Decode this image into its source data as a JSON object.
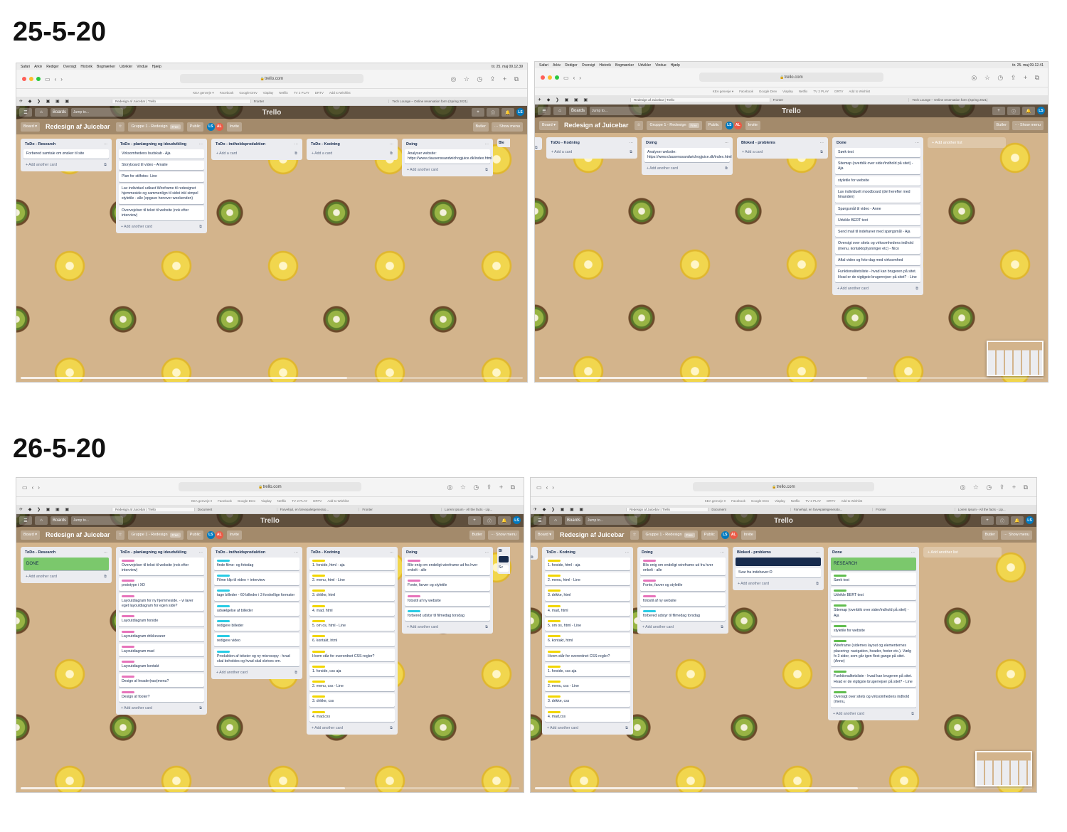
{
  "headings": [
    "25-5-20",
    "26-5-20"
  ],
  "menubar": {
    "apple": "",
    "items": [
      "Safari",
      "Arkiv",
      "Rediger",
      "Oversigt",
      "Historik",
      "Bogmærker",
      "Udvikler",
      "Vindue",
      "Hjælp"
    ],
    "clock_1": "tir. 25. maj 09.12.39",
    "clock_2": "tir. 25. maj 09.12.41"
  },
  "browser": {
    "url": "trello.com",
    "bookmarks": [
      "KEA genveje ▾",
      "Facebook",
      "Google Drev",
      "Viaplay",
      "Netflix",
      "TV 2 PLAY",
      "DRTV",
      "Add to Wishlist"
    ],
    "tabs_a": [
      "Redesign af Juicebar | Trello",
      "Fronter",
      "Tech Lounge – Online reservation form (Spring 2021)"
    ],
    "tabs_b": [
      "Redesign af Juicebar | Trello",
      "Document",
      "Farvehjul, en farvepaletgenerato...",
      "Fronter",
      "Lorem Ipsum - All the facts - Lip..."
    ],
    "pins": "✈ ◆ ❯ ▣ ▣ ▣"
  },
  "trello": {
    "logo": "Trello",
    "boards": "Boards",
    "jump": "Jump to...",
    "board_menu": "Board ▾",
    "board_title": "Redesign af Juicebar",
    "star": "☆",
    "team": "Gruppe 1 - Redesign",
    "free": "Free",
    "public": "Public",
    "invite": "Invite",
    "butler": "Butler",
    "show_menu": "··· Show menu",
    "add_card": "+ Add a card",
    "add_another_card": "+ Add another card",
    "add_another_list": "+ Add another list",
    "list_menu": "···",
    "template_icon": "⧉",
    "avatars": [
      "LS",
      "AL"
    ],
    "user": "LS"
  },
  "colors": {
    "pink": "#e774bb",
    "blue": "#29cce5",
    "yellow": "#f2d600",
    "green": "#61bd4f",
    "navy": "#172b4d",
    "done_cover": "#7bc86c",
    "avatar_blue": "#0079bf",
    "avatar_red": "#eb5a46"
  },
  "shot1": {
    "lists": [
      {
        "title": "ToDo - Research",
        "cards": [
          "Forbered samtale om ønsker til site"
        ],
        "footer": "+ Add another card"
      },
      {
        "title": "ToDo - planlægning og ideudvikling",
        "cards": [
          "Virksomhedens budskab - Aja",
          "Storyboard til video - Amalie",
          "Plan for stilfotos- Line",
          "Lav individuel udkast Wireframe til redesignet hjemmeside og sammenlign til sidst inkl simpel styletile - alle (opgave henover weekenden)",
          "Overvejelser til tekst til website (nok efter interview)"
        ],
        "footer": "+ Add another card"
      },
      {
        "title": "ToDo - indholdsproduktion",
        "cards": [],
        "footer": "+ Add a card"
      },
      {
        "title": "ToDo - Kodning",
        "cards": [],
        "footer": "+ Add a card"
      },
      {
        "title": "Doing",
        "cards": [
          "Analyser website: https://www.clausenssandwichogjuice.dk/index.html"
        ],
        "footer": "+ Add another card"
      }
    ],
    "peek": "Ble"
  },
  "shot2": {
    "lists": [
      {
        "title": "ToDo - Kodning",
        "cards": [],
        "footer": "+ Add a card"
      },
      {
        "title": "Doing",
        "cards": [
          "Analyser website: https://www.clausenssandwichogjuice.dk/index.html"
        ],
        "footer": "+ Add another card"
      },
      {
        "title": "Bloked - problems",
        "cards": [],
        "footer": "+ Add a card"
      },
      {
        "title": "Done",
        "cards": [
          "Søek test",
          "Sitemap (overblik over sider/indhold på sitet) - Aja",
          "styletile for website",
          "Lav individuelt moodboard (del herefter med hinanden)",
          "Spørgsmål til video - Anne",
          "Udvikle BERT test",
          "Send mail til indehaver med spørgsmål - Aja",
          "Oversigt over sitets og virksomhedens indhold (menu, kontaktoplysninger etc) - Nico",
          "Aftal video og foto-dag med virksomhed",
          "Funktionalitetsliste - hvad kan brugeren på sitet. Hvad er de vigtigste brugerrejser på sitet? - Line"
        ],
        "footer": "+ Add another card"
      }
    ]
  },
  "shot3": {
    "research": {
      "title": "ToDo - Research",
      "cover": "DONE",
      "footer": "+ Add another card"
    },
    "planning": {
      "title": "ToDo - planlægning og ideudvikling",
      "cards": [
        {
          "label": "pink",
          "text": "Overvejelser til tekst til website (nok efter interview)"
        },
        {
          "label": "pink",
          "text": "prototype i XD"
        },
        {
          "label": "pink",
          "text": "Layoutdiagram for ny hjemmeside. - vi laver eget layoutdiagram for egen side?"
        },
        {
          "label": "pink",
          "text": "Layoutdiagram forside"
        },
        {
          "label": "pink",
          "text": "Layoutdiagram drikkevarer"
        },
        {
          "label": "pink",
          "text": "Layoutdiagram mad"
        },
        {
          "label": "pink",
          "text": "Layoutdiagram kontakt"
        },
        {
          "label": "pink",
          "text": "Design af header|nav|menu?"
        },
        {
          "label": "pink",
          "text": "Design af footer?"
        }
      ],
      "footer": "+ Add another card"
    },
    "content": {
      "title": "ToDo - indholdsproduktion",
      "cards": [
        {
          "label": "blue",
          "text": "finde filme- og fotodag"
        },
        {
          "label": "blue",
          "text": "Filme klip til video + interview"
        },
        {
          "label": "blue",
          "text": "tage billeder - 60 billeder i 3 forskellige formater"
        },
        {
          "label": "blue",
          "text": "udvælgelse af billeder"
        },
        {
          "label": "blue",
          "text": "redigere billeder"
        },
        {
          "label": "blue",
          "text": "redigere video"
        },
        {
          "label": "blue",
          "text": "Produktion af tekster og ny microcopy - hvad skal beholdes og hvad skal skrives om."
        }
      ],
      "footer": "+ Add another card"
    },
    "coding": {
      "title": "ToDo - Kodning",
      "cards": [
        {
          "label": "yellow",
          "text": "1. forside, html - aja"
        },
        {
          "label": "yellow",
          "text": "2. menu, html - Line"
        },
        {
          "label": "yellow",
          "text": "3. drikke, html"
        },
        {
          "label": "yellow",
          "text": "4. mad, html"
        },
        {
          "label": "yellow",
          "text": "5. om os, html - Line"
        },
        {
          "label": "yellow",
          "text": "6. kontakt, html"
        },
        {
          "label": "yellow",
          "text": "Hvem står for overordnet CSS-regler?"
        },
        {
          "label": "yellow",
          "text": "1. forside, css aja"
        },
        {
          "label": "yellow",
          "text": "2. menu, css - Line"
        },
        {
          "label": "yellow",
          "text": "3. drikke, css"
        },
        {
          "label": "yellow",
          "text": "4. mad,css"
        }
      ],
      "footer": "+ Add another card"
    },
    "doing": {
      "title": "Doing",
      "cards": [
        {
          "label": "pink",
          "text": "Bliv enig om endeligt wireframe ud fra hver enkelt - alle"
        },
        {
          "label": "pink",
          "text": "Fonte, farver og styletile"
        },
        {
          "label": "pink",
          "text": "fotostil af ny website"
        },
        {
          "label": "blue",
          "text": "forbered udstyr til filmedag torsdag"
        }
      ],
      "footer": "+ Add another card"
    },
    "peek": "Bl",
    "peek2": "Sv"
  },
  "shot4": {
    "coding": {
      "title": "ToDo - Kodning",
      "cards": [
        {
          "label": "yellow",
          "text": "1. forside, html - aja"
        },
        {
          "label": "yellow",
          "text": "2. menu, html - Line"
        },
        {
          "label": "yellow",
          "text": "3. drikke, html"
        },
        {
          "label": "yellow",
          "text": "4. mad, html"
        },
        {
          "label": "yellow",
          "text": "5. om os, html - Line"
        },
        {
          "label": "yellow",
          "text": "6. kontakt, html"
        },
        {
          "label": "yellow",
          "text": "Hvem står for overordnet CSS-regler?"
        },
        {
          "label": "yellow",
          "text": "1. forside, css aja"
        },
        {
          "label": "yellow",
          "text": "2. menu, css - Line"
        },
        {
          "label": "yellow",
          "text": "3. drikke, css"
        },
        {
          "label": "yellow",
          "text": "4. mad,css"
        }
      ],
      "footer": "+ Add another card"
    },
    "doing": {
      "title": "Doing",
      "cards": [
        {
          "label": "pink",
          "text": "Bliv enig om endeligt wireframe ud fra hver enkelt - alle"
        },
        {
          "label": "pink",
          "text": "Fonte, farver og styletile"
        },
        {
          "label": "pink",
          "text": "fotostil af ny website"
        },
        {
          "label": "blue",
          "text": "forbered udstyr til filmedag torsdag"
        }
      ],
      "footer": "+ Add another card"
    },
    "blocked": {
      "title": "Bloked - problems",
      "cards": [
        {
          "label": "",
          "text": "Svar fra indehaver:D"
        }
      ],
      "footer": "+ Add another card"
    },
    "done": {
      "title": "Done",
      "cover": "RESEARCH",
      "cards": [
        {
          "label": "green",
          "text": "Søek test"
        },
        {
          "label": "green",
          "text": "Udvikle BERT test"
        },
        {
          "label": "green",
          "text": "Sitemap (overblik over sider/indhold på sitet) - Aja"
        },
        {
          "label": "green",
          "text": "styletile for website"
        },
        {
          "label": "green",
          "text": "Wireframe (sidernes layout og elementernes placering: navigation, header, footer etc.). Vælg fx 3 sider, som går igen flest gange på sitet. (Anne)"
        },
        {
          "label": "green",
          "text": "Funktionalitetsliste - hvad kan brugeren på sitet. Hvad er de vigtigste brugerrejser på sitet? - Line"
        },
        {
          "label": "green",
          "text": "Oversigt over sitets og virksomhedens indhold (menu,"
        }
      ],
      "footer": "+ Add another card"
    }
  }
}
